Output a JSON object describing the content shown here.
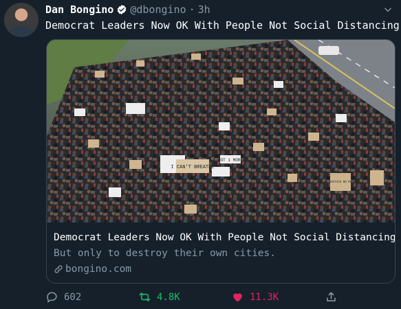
{
  "tweet": {
    "author_name": "Dan Bongino",
    "handle": "@dbongino",
    "separator": "·",
    "time": "3h",
    "text": "Democrat Leaders Now OK With People Not Social Distancing"
  },
  "card": {
    "title": "Democrat Leaders Now OK With People Not Social Distancing",
    "description": "But only to destroy their own cities.",
    "domain": "bongino.com",
    "image_signs": [
      "I CAN'T BREATHE",
      "NOT 1 MORE",
      "NO JUSTICE NO PEACE"
    ]
  },
  "actions": {
    "reply_count": "602",
    "retweet_count": "4.8K",
    "like_count": "11.3K"
  },
  "icons": {
    "verified": "verified-badge-icon",
    "menu": "chevron-down-icon",
    "link": "link-icon",
    "reply": "reply-icon",
    "retweet": "retweet-icon",
    "like": "heart-icon",
    "share": "share-icon"
  },
  "colors": {
    "background": "#15202b",
    "secondary_text": "#8899a6",
    "retweet_active": "#17bf63",
    "like_active": "#e0245e",
    "verified": "#ffffff"
  }
}
